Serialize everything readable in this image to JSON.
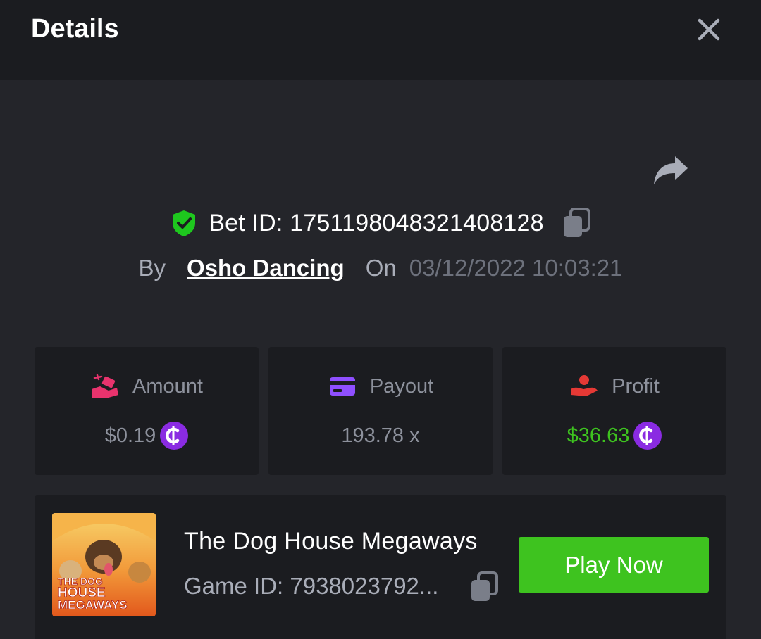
{
  "header": {
    "title": "Details"
  },
  "bet": {
    "id_text": "Bet ID: 1751198048321408128",
    "by_label": "By",
    "user": "Osho Dancing",
    "on_label": "On",
    "datetime": "03/12/2022 10:03:21"
  },
  "stats": [
    {
      "label": "Amount",
      "value": "$0.19",
      "icon": "hand-coins-icon",
      "currency_icon": "coin-icon"
    },
    {
      "label": "Payout",
      "value": "193.78 x",
      "icon": "credit-card-icon"
    },
    {
      "label": "Profit",
      "value": "$36.63",
      "icon": "hand-money-icon",
      "currency_icon": "coin-icon"
    }
  ],
  "game": {
    "name": "The Dog House Megaways",
    "id_text": "Game ID: 7938023792...",
    "play_label": "Play Now",
    "thumb_text_1": "THE DOG",
    "thumb_text_2": "HOUSE",
    "thumb_text_3": "MEGAWAYS"
  },
  "colors": {
    "background": "#24252a",
    "panel": "#1b1c20",
    "accent_green": "#3ec31f",
    "coin_purple": "#8a2be2",
    "amount_icon": "#e8336d",
    "payout_icon": "#8f4fff",
    "profit_icon": "#e53935"
  }
}
